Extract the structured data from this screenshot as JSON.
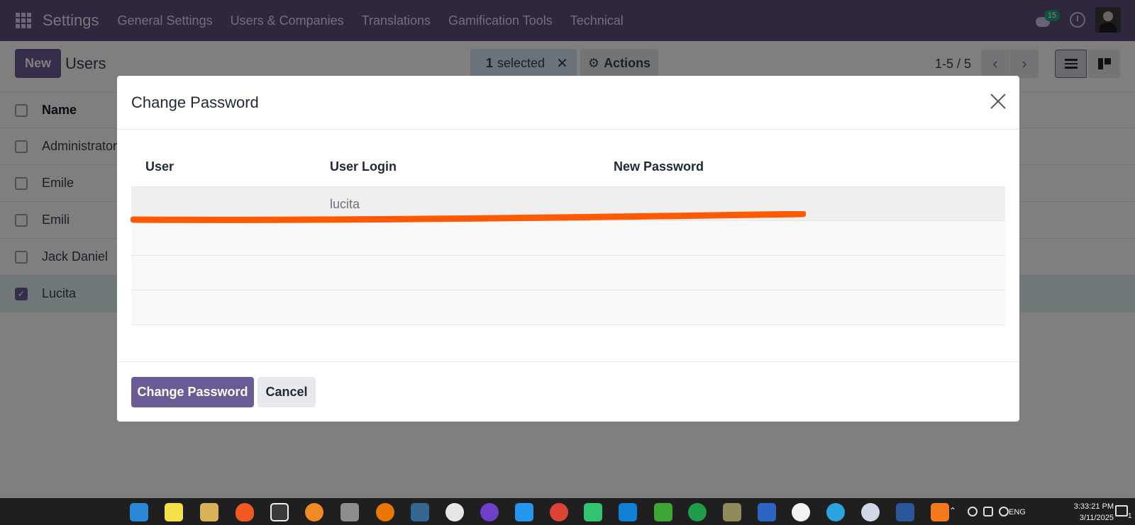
{
  "navbar": {
    "brand": "Settings",
    "menu": [
      "General Settings",
      "Users & Companies",
      "Translations",
      "Gamification Tools",
      "Technical"
    ],
    "chat_badge": "15"
  },
  "control_panel": {
    "new_label": "New",
    "title": "Users",
    "selected_count": "1",
    "selected_label": "selected",
    "selected_close": "✕",
    "actions_label": "Actions",
    "pager_text": "1-5 / 5"
  },
  "list": {
    "header": "Name",
    "rows": [
      "Administrator",
      "Emile",
      "Emili",
      "Jack Daniel",
      "Lucita"
    ]
  },
  "modal": {
    "title": "Change Password",
    "columns": [
      "User",
      "User Login",
      "New Password"
    ],
    "rows": [
      {
        "user": "",
        "login": "lucita",
        "password": ""
      }
    ],
    "primary_button": "Change Password",
    "secondary_button": "Cancel"
  },
  "taskbar": {
    "lang": "ENG",
    "time": "3:33:21 PM",
    "date": "3/11/2025",
    "notification_count": "1"
  },
  "colors": {
    "navbar": "#5c4f7d",
    "primary": "#6b5b95",
    "annotation_line": "#ff5a00"
  }
}
